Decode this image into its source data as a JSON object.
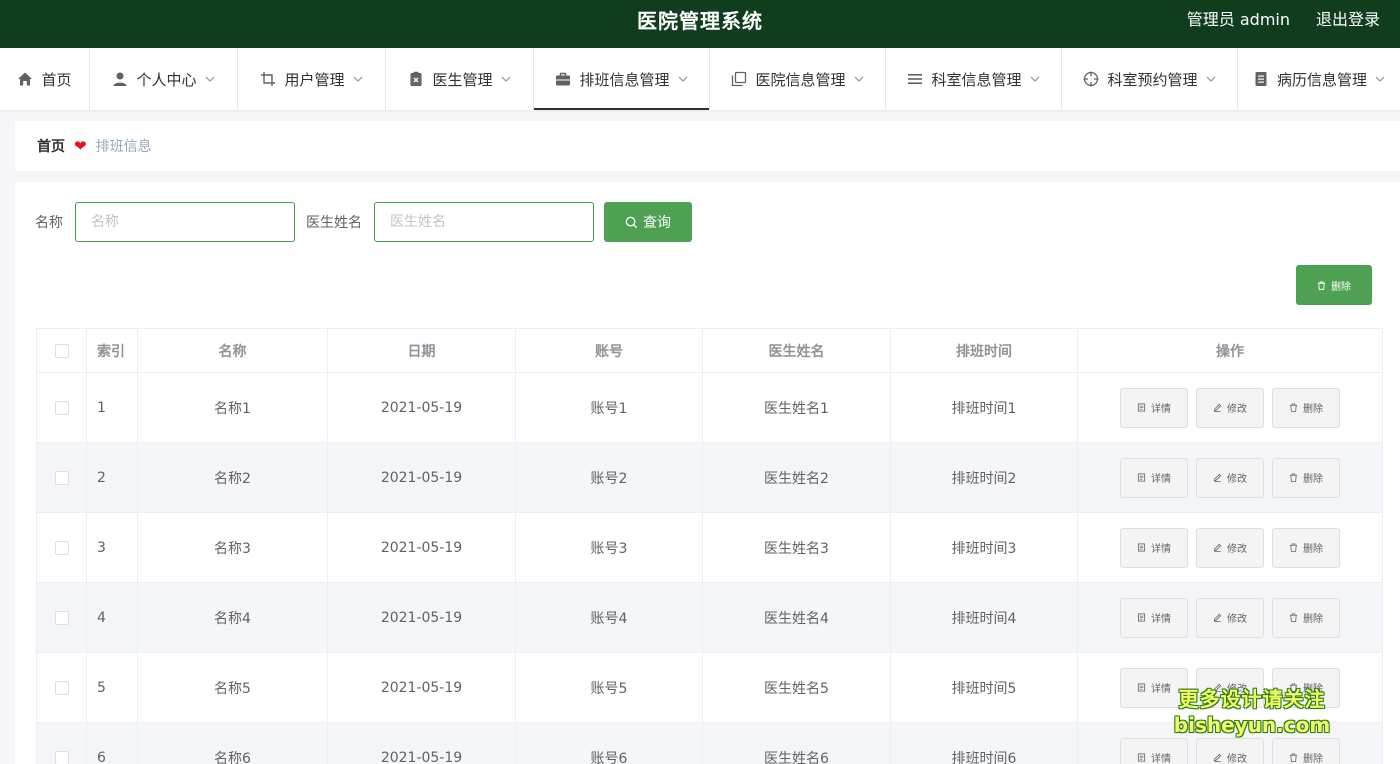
{
  "header": {
    "title": "医院管理系统",
    "admin_info": "管理员 admin",
    "logout_label": "退出登录",
    "bg_color": "#0f3d1e"
  },
  "nav": {
    "items": [
      {
        "label": "首页",
        "icon": "home-icon",
        "has_dropdown": false
      },
      {
        "label": "个人中心",
        "icon": "user-icon",
        "has_dropdown": true
      },
      {
        "label": "用户管理",
        "icon": "crop-icon",
        "has_dropdown": true
      },
      {
        "label": "医生管理",
        "icon": "doc-close-icon",
        "has_dropdown": true
      },
      {
        "label": "排班信息管理",
        "icon": "briefcase-icon",
        "has_dropdown": true,
        "active": true
      },
      {
        "label": "医院信息管理",
        "icon": "copy-icon",
        "has_dropdown": true
      },
      {
        "label": "科室信息管理",
        "icon": "list-icon",
        "has_dropdown": true
      },
      {
        "label": "科室预约管理",
        "icon": "aim-icon",
        "has_dropdown": true
      },
      {
        "label": "病历信息管理",
        "icon": "document-icon",
        "has_dropdown": true
      }
    ]
  },
  "breadcrumb": {
    "home": "首页",
    "current": "排班信息"
  },
  "search": {
    "name_label": "名称",
    "name_placeholder": "名称",
    "doctor_label": "医生姓名",
    "doctor_placeholder": "医生姓名",
    "query_label": "查询"
  },
  "toolbar": {
    "delete_label": "删除",
    "accent_color": "#4ea152"
  },
  "table": {
    "columns": [
      "索引",
      "名称",
      "日期",
      "账号",
      "医生姓名",
      "排班时间",
      "操作"
    ],
    "rows": [
      {
        "index": "1",
        "name": "名称1",
        "date": "2021-05-19",
        "account": "账号1",
        "doctor": "医生姓名1",
        "schedule": "排班时间1"
      },
      {
        "index": "2",
        "name": "名称2",
        "date": "2021-05-19",
        "account": "账号2",
        "doctor": "医生姓名2",
        "schedule": "排班时间2"
      },
      {
        "index": "3",
        "name": "名称3",
        "date": "2021-05-19",
        "account": "账号3",
        "doctor": "医生姓名3",
        "schedule": "排班时间3"
      },
      {
        "index": "4",
        "name": "名称4",
        "date": "2021-05-19",
        "account": "账号4",
        "doctor": "医生姓名4",
        "schedule": "排班时间4"
      },
      {
        "index": "5",
        "name": "名称5",
        "date": "2021-05-19",
        "account": "账号5",
        "doctor": "医生姓名5",
        "schedule": "排班时间5"
      },
      {
        "index": "6",
        "name": "名称6",
        "date": "2021-05-19",
        "account": "账号6",
        "doctor": "医生姓名6",
        "schedule": "排班时间6"
      }
    ],
    "actions": {
      "detail": "详情",
      "edit": "修改",
      "delete": "删除"
    }
  },
  "watermark": {
    "line1": "更多设计请关注",
    "line2": "bisheyun.com"
  }
}
